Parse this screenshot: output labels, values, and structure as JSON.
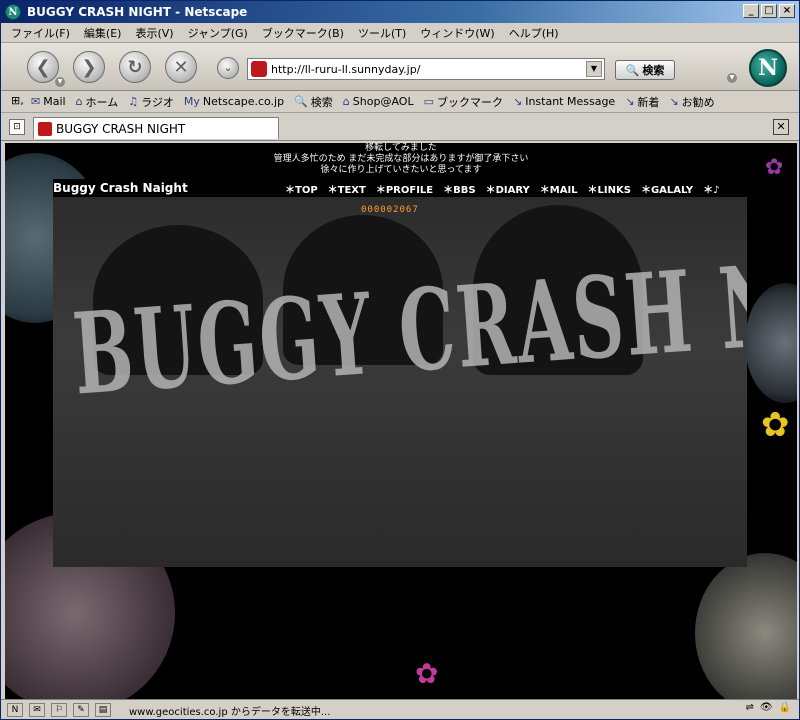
{
  "window": {
    "title": "BUGGY CRASH NIGHT - Netscape",
    "app_icon": "N"
  },
  "menu": [
    "ファイル(F)",
    "編集(E)",
    "表示(V)",
    "ジャンプ(G)",
    "ブックマーク(B)",
    "ツール(T)",
    "ウィンドウ(W)",
    "ヘルプ(H)"
  ],
  "navigation": {
    "url": "http://ll-ruru-ll.sunnyday.jp/",
    "search_label": "検索",
    "brand_letter": "N"
  },
  "personal_toolbar": [
    "Mail",
    "ホーム",
    "ラジオ",
    "Netscape.co.jp",
    "検索",
    "Shop@AOL",
    "ブックマーク",
    "Instant Message",
    "新着",
    "お勧め"
  ],
  "tab": {
    "label": "BUGGY CRASH NIGHT"
  },
  "page": {
    "notice_lines": [
      "移転してみました",
      "管理人多忙のため まだ未完成な部分はありますが御了承下さい",
      "徐々に作り上げていきたいと思ってます"
    ],
    "site_name": "Buggy Crash Naight",
    "nav_links": [
      "＊TOP",
      "＊TEXT",
      "＊PROFILE",
      "＊BBS",
      "＊DIARY",
      "＊MAIL",
      "＊LINKS",
      "＊GALALY",
      "＊♪"
    ],
    "counter": "000002067",
    "banner_text": "BUGGY CRASH NIGHT"
  },
  "status": {
    "text": "www.geocities.co.jp からデータを転送中..."
  }
}
